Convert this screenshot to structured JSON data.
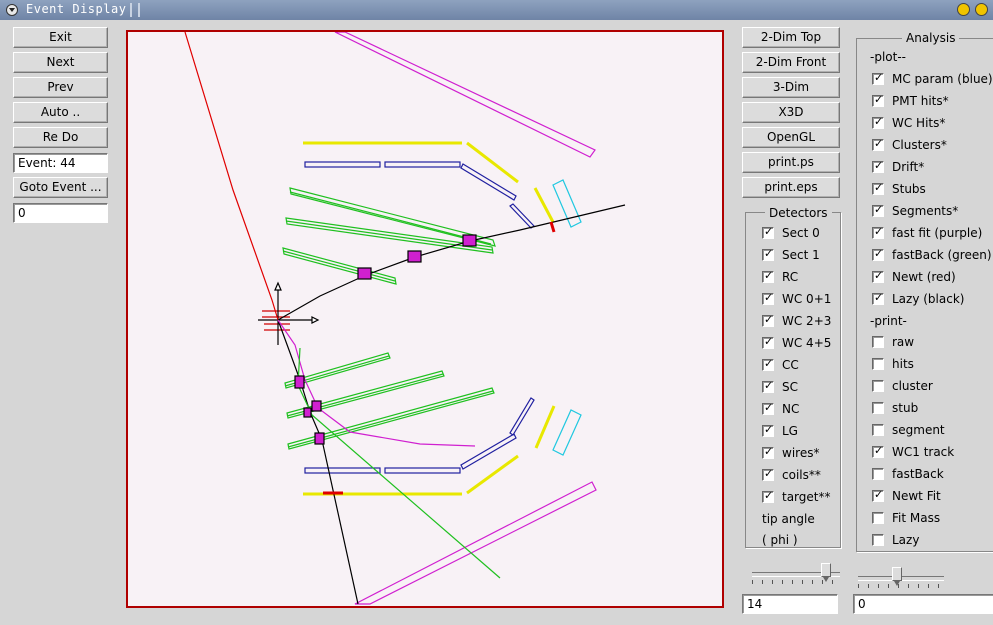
{
  "window": {
    "title": "Event Display"
  },
  "left_panel": {
    "buttons": [
      "Exit",
      "Next",
      "Prev",
      "Auto ..",
      "Re Do"
    ],
    "event_field": "Event: 44",
    "goto_button": "Goto Event ...",
    "goto_value": "0"
  },
  "view_buttons": [
    "2-Dim Top",
    "2-Dim Front",
    "3-Dim",
    "X3D",
    "OpenGL",
    "print.ps",
    "print.eps"
  ],
  "detectors": {
    "title": "Detectors",
    "items": [
      {
        "label": "Sect 0",
        "checked": true
      },
      {
        "label": "Sect 1",
        "checked": true
      },
      {
        "label": "RC",
        "checked": true
      },
      {
        "label": "WC 0+1",
        "checked": true
      },
      {
        "label": "WC 2+3",
        "checked": true
      },
      {
        "label": "WC 4+5",
        "checked": true
      },
      {
        "label": "CC",
        "checked": true
      },
      {
        "label": "SC",
        "checked": true
      },
      {
        "label": "NC",
        "checked": true
      },
      {
        "label": "LG",
        "checked": true
      },
      {
        "label": "wires*",
        "checked": true
      },
      {
        "label": "coils**",
        "checked": true
      },
      {
        "label": "target**",
        "checked": true
      }
    ],
    "tip_label_1": "tip angle",
    "tip_label_2": "( phi )",
    "slider_value": "14",
    "slider_level": 0.88
  },
  "analysis": {
    "title": "Analysis",
    "plot_header": "-plot--",
    "plot_items": [
      {
        "label": "MC param (blue)",
        "checked": true
      },
      {
        "label": "PMT hits*",
        "checked": true
      },
      {
        "label": "WC Hits*",
        "checked": true
      },
      {
        "label": "Clusters*",
        "checked": true
      },
      {
        "label": "Drift*",
        "checked": true
      },
      {
        "label": "Stubs",
        "checked": true
      },
      {
        "label": "Segments*",
        "checked": true
      },
      {
        "label": "fast fit (purple)",
        "checked": true
      },
      {
        "label": "fastBack (green)",
        "checked": true
      },
      {
        "label": "Newt (red)",
        "checked": true
      },
      {
        "label": "Lazy (black)",
        "checked": true
      }
    ],
    "print_header": "-print-",
    "print_items": [
      {
        "label": "raw",
        "checked": false
      },
      {
        "label": "hits",
        "checked": false
      },
      {
        "label": "cluster",
        "checked": false
      },
      {
        "label": "stub",
        "checked": false
      },
      {
        "label": "segment",
        "checked": false
      },
      {
        "label": "WC1 track",
        "checked": true
      },
      {
        "label": "fastBack",
        "checked": false
      },
      {
        "label": "Newt Fit",
        "checked": true
      },
      {
        "label": "Fit Mass",
        "checked": false
      },
      {
        "label": "Lazy",
        "checked": false
      }
    ],
    "slider_value": "0",
    "slider_level": 0.45
  },
  "colors": {
    "frame": "#b00000",
    "yellow": "#ffff00",
    "blue": "#2020a0",
    "green": "#20c020",
    "magenta": "#d020d0",
    "cyan": "#20c8e0",
    "red": "#e00000"
  }
}
